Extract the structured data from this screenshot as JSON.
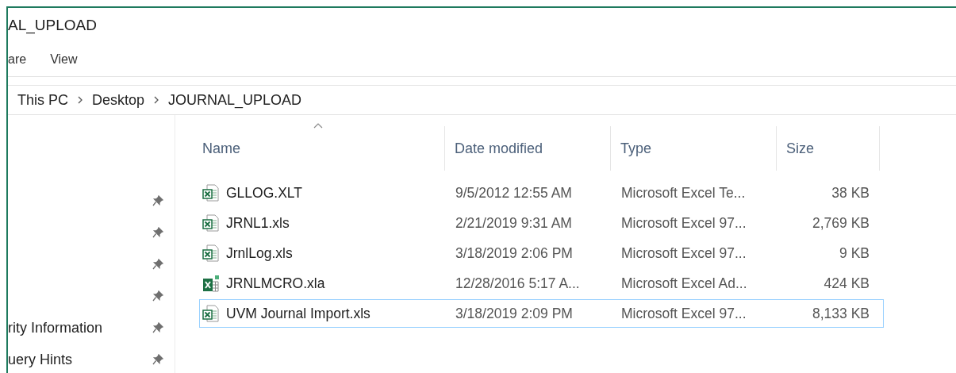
{
  "window": {
    "title": "AL_UPLOAD"
  },
  "ribbon_tabs": [
    {
      "label": "are"
    },
    {
      "label": "View"
    }
  ],
  "breadcrumb": [
    "This PC",
    "Desktop",
    "JOURNAL_UPLOAD"
  ],
  "quick_access": [
    {
      "pinned": true
    },
    {
      "pinned": true
    },
    {
      "pinned": true
    },
    {
      "pinned": true
    },
    {
      "label": "rity Information",
      "pinned": true
    },
    {
      "label": "uery Hints",
      "pinned": true
    }
  ],
  "table": {
    "columns": [
      {
        "label": "Name",
        "sorted": true
      },
      {
        "label": "Date modified",
        "sorted": false
      },
      {
        "label": "Type",
        "sorted": false
      },
      {
        "label": "Size",
        "sorted": false
      }
    ],
    "rows": [
      {
        "kind": "workbook",
        "name": "GLLOG.XLT",
        "date": "9/5/2012 12:55 AM",
        "type": "Microsoft Excel Te...",
        "size": "38 KB",
        "focused": false
      },
      {
        "kind": "workbook",
        "name": "JRNL1.xls",
        "date": "2/21/2019 9:31 AM",
        "type": "Microsoft Excel 97...",
        "size": "2,769 KB",
        "focused": false
      },
      {
        "kind": "workbook",
        "name": "JrnlLog.xls",
        "date": "3/18/2019 2:06 PM",
        "type": "Microsoft Excel 97...",
        "size": "9 KB",
        "focused": false
      },
      {
        "kind": "addin",
        "name": "JRNLMCRO.xla",
        "date": "12/28/2016 5:17 A...",
        "type": "Microsoft Excel Ad...",
        "size": "424 KB",
        "focused": false
      },
      {
        "kind": "workbook",
        "name": "UVM Journal Import.xls",
        "date": "3/18/2019 2:09 PM",
        "type": "Microsoft Excel 97...",
        "size": "8,133 KB",
        "focused": true
      }
    ]
  }
}
